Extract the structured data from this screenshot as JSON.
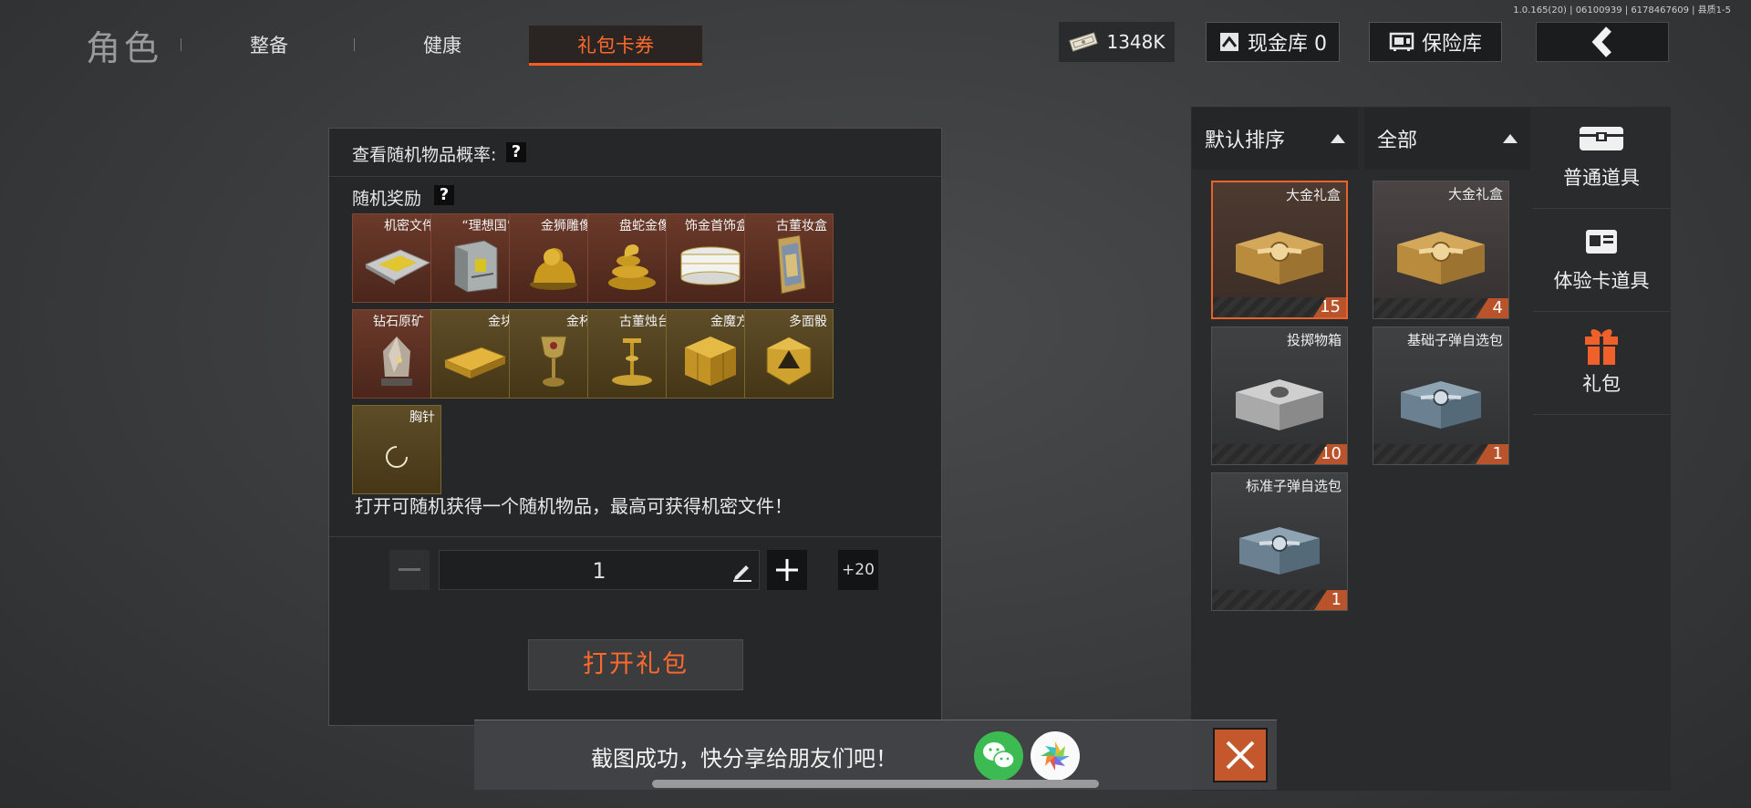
{
  "version_text": "1.0.165(20) | 06100939 | 6178467609 | 县质1-5",
  "header": {
    "title": "角色",
    "tabs": [
      {
        "label": "整备"
      },
      {
        "label": "健康"
      },
      {
        "label": "礼包卡券",
        "active": true
      }
    ],
    "money": "1348K",
    "cash_vault": "现金库 0",
    "insurance": "保险库"
  },
  "dialog": {
    "prob_label": "查看随机物品概率:",
    "help_mark": "?",
    "reward_label": "随机奖励",
    "rewards": [
      {
        "label": "机密文件",
        "style": "red"
      },
      {
        "label": "“理想国”",
        "style": "red"
      },
      {
        "label": "金狮雕像",
        "style": "red"
      },
      {
        "label": "盘蛇金像",
        "style": "red"
      },
      {
        "label": "饰金首饰盒",
        "style": "red"
      },
      {
        "label": "古董妆盒",
        "style": "red"
      },
      {
        "label": "钻石原矿",
        "style": "red"
      },
      {
        "label": "金块",
        "style": "gold"
      },
      {
        "label": "金杯",
        "style": "gold"
      },
      {
        "label": "古董烛台",
        "style": "gold"
      },
      {
        "label": "金魔方",
        "style": "gold"
      },
      {
        "label": "多面骰",
        "style": "gold"
      },
      {
        "label": "胸针",
        "style": "gold"
      }
    ],
    "description": "打开可随机获得一个随机物品，最高可获得机密文件！",
    "quantity": "1",
    "plus_20": "+20",
    "open_button": "打开礼包"
  },
  "inventory": {
    "sort_label": "默认排序",
    "filter_label": "全部",
    "items": [
      {
        "name": "大金礼盒",
        "count": "15",
        "selected": true,
        "kind": "gold"
      },
      {
        "name": "大金礼盒",
        "count": "4",
        "kind": "gold"
      },
      {
        "name": "投掷物箱",
        "count": "10",
        "kind": "silver"
      },
      {
        "name": "基础子弹自选包",
        "count": "1",
        "kind": "steel"
      },
      {
        "name": "标准子弹自选包",
        "count": "1",
        "kind": "steel"
      }
    ]
  },
  "categories": [
    {
      "label": "普通道具",
      "icon": "chest-icon"
    },
    {
      "label": "体验卡道具",
      "icon": "card-icon"
    },
    {
      "label": "礼包",
      "icon": "gift-icon",
      "active": true
    }
  ],
  "toast": {
    "text": "截图成功，快分享给朋友们吧！"
  },
  "colors": {
    "accent": "#ff6a2c",
    "count_badge": "#b8532b",
    "wechat": "#3dbb53"
  }
}
